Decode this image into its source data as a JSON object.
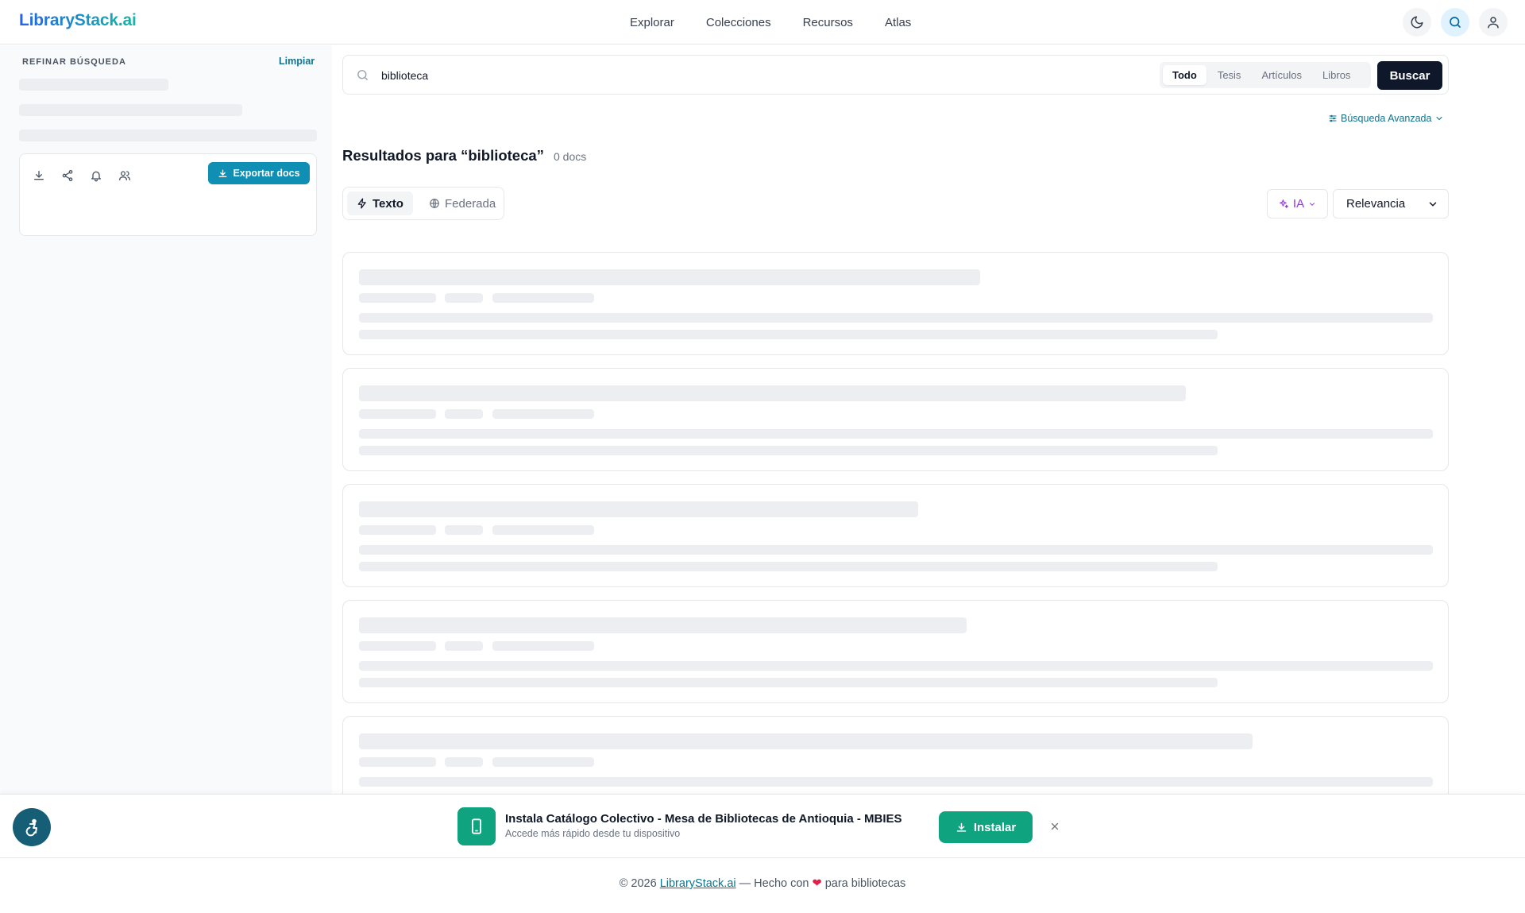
{
  "header": {
    "brand": "LibraryStack.ai",
    "nav": [
      "Explorar",
      "Colecciones",
      "Recursos",
      "Atlas"
    ]
  },
  "sidebar": {
    "title": "REFINAR BÚSQUEDA",
    "clear_label": "Limpiar",
    "export_label": "Exportar docs"
  },
  "search": {
    "value": "biblioteca",
    "filters": [
      "Todo",
      "Tesis",
      "Artículos",
      "Libros"
    ],
    "active_filter": "Todo",
    "submit_label": "Buscar",
    "advanced_label": "Búsqueda Avanzada"
  },
  "results": {
    "title": "Resultados para “biblioteca”",
    "count": "0 docs",
    "modes": [
      "Texto",
      "Federada"
    ],
    "ai_label": "IA",
    "sort_value": "Relevancia"
  },
  "install_banner": {
    "title": "Instala Catálogo Colectivo - Mesa de Bibliotecas de Antioquia - MBIES",
    "subtitle": "Accede más rápido desde tu dispositivo",
    "button_label": "Instalar"
  },
  "footer": {
    "prefix": "© 2026",
    "link": "LibraryStack.ai",
    "middle": "— Hecho con",
    "suffix": "para bibliotecas"
  },
  "colors": {
    "accent": "#0e8fb3",
    "install_green": "#10a37f",
    "dark_button": "#0f172a",
    "ai_purple": "#9333ea"
  }
}
